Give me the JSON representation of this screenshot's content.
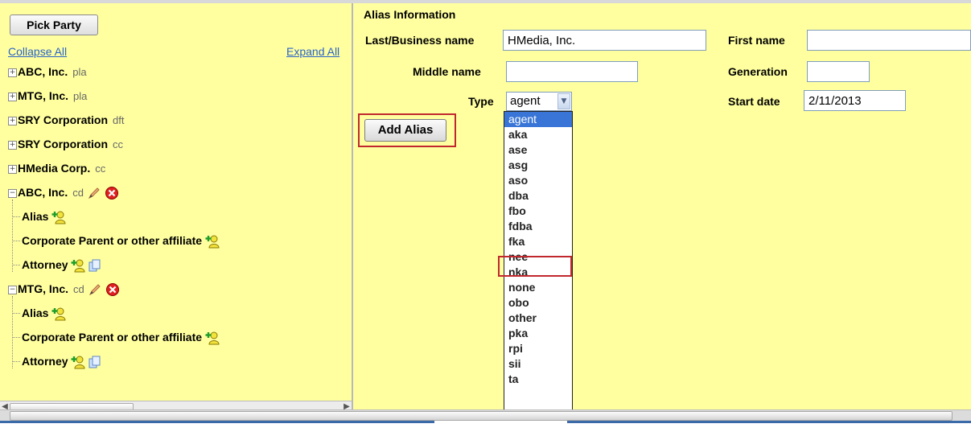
{
  "left_pane": {
    "pick_party_label": "Pick Party",
    "collapse_all": "Collapse All",
    "expand_all": "Expand All",
    "parties": [
      {
        "name": "ABC, Inc.",
        "code": "pla"
      },
      {
        "name": "MTG, Inc.",
        "code": "pla"
      },
      {
        "name": "SRY Corporation",
        "code": "dft"
      },
      {
        "name": "SRY Corporation",
        "code": "cc"
      },
      {
        "name": "HMedia Corp.",
        "code": "cc"
      },
      {
        "name": "ABC, Inc.",
        "code": "cd"
      },
      {
        "name": "MTG, Inc.",
        "code": "cd"
      }
    ],
    "children": {
      "alias": "Alias",
      "corporate": "Corporate Parent or other affiliate",
      "attorney": "Attorney"
    }
  },
  "form": {
    "section_title": "Alias Information",
    "last_business_label": "Last/Business name",
    "last_business_value": "HMedia, Inc.",
    "first_name_label": "First name",
    "first_name_value": "",
    "middle_name_label": "Middle name",
    "middle_name_value": "",
    "generation_label": "Generation",
    "generation_value": "",
    "type_label": "Type",
    "type_value": "agent",
    "start_date_label": "Start date",
    "start_date_value": "2/11/2013",
    "add_alias_label": "Add Alias"
  },
  "type_options": [
    "agent",
    "aka",
    "ase",
    "asg",
    "aso",
    "dba",
    "fbo",
    "fdba",
    "fka",
    "nee",
    "nka",
    "none",
    "obo",
    "other",
    "pka",
    "rpi",
    "sii",
    "ta"
  ],
  "selected_option": "agent",
  "highlighted_option": "fka",
  "colors": {
    "background": "#ffffa0",
    "highlight_border": "#c0282d",
    "selection": "#3875d7",
    "link": "#2a64c8"
  }
}
